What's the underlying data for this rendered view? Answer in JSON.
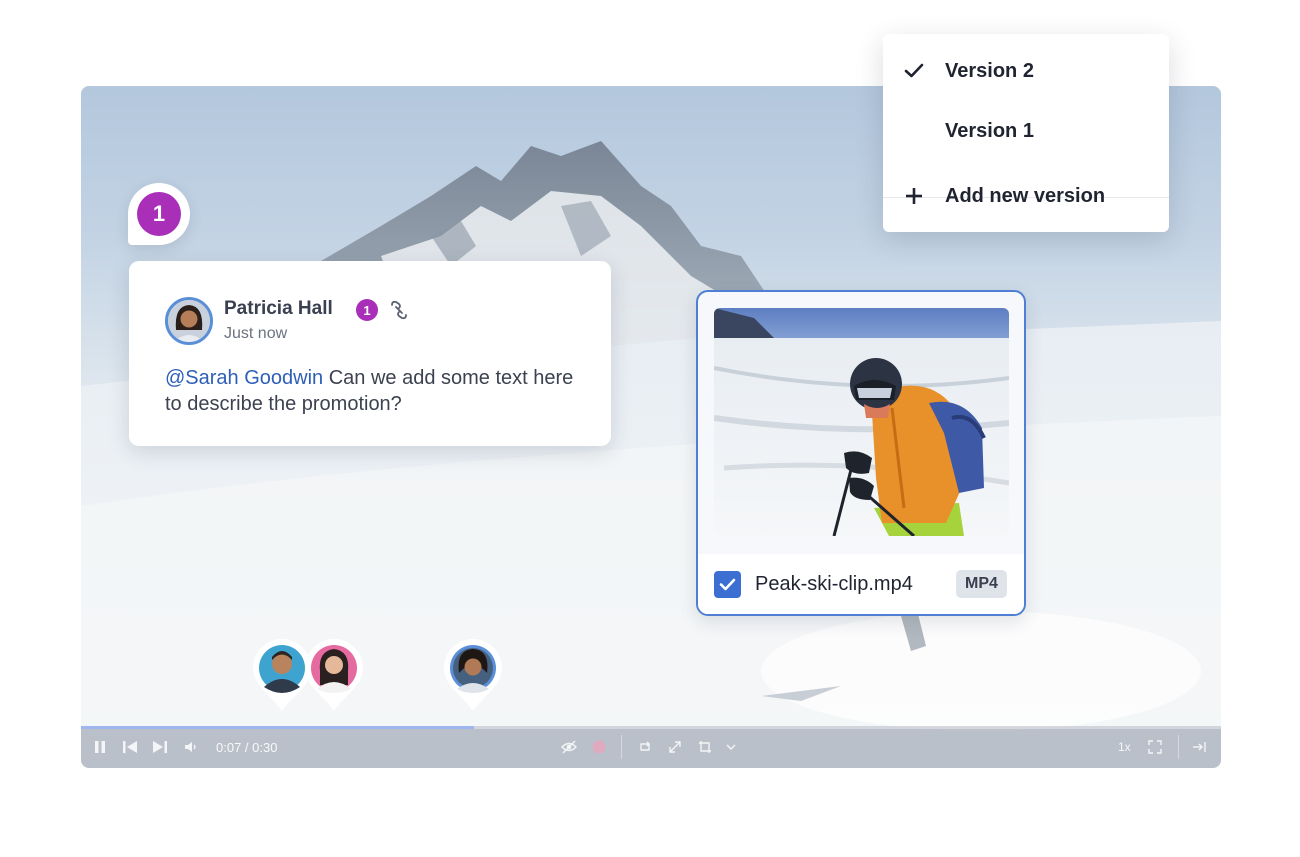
{
  "comment": {
    "pin_number": "1",
    "author": "Patricia Hall",
    "badge": "1",
    "time": "Just now",
    "mention": "@Sarah Goodwin",
    "text": " Can we add some text here to describe the promotion?"
  },
  "version_menu": {
    "items": [
      {
        "label": "Version 2",
        "icon": "checkmark-icon",
        "selected": true
      },
      {
        "label": "Version 1",
        "icon": "",
        "selected": false
      }
    ],
    "add_label": "Add new version",
    "add_icon": "plus-icon"
  },
  "asset": {
    "name": "Peak-ski-clip.mp4",
    "type": "MP4",
    "checked": true
  },
  "player": {
    "time": "0:07 / 0:30",
    "speed": "1x",
    "progress": 0.345
  },
  "colors": {
    "accent_purple": "#a92fb8",
    "accent_blue": "#3b6fd1",
    "mention_blue": "#2d5fb8"
  }
}
